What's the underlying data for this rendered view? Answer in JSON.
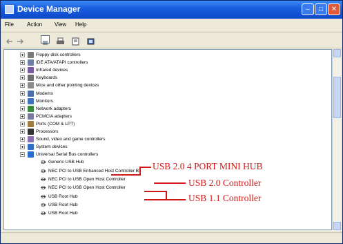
{
  "window": {
    "title": "Device Manager"
  },
  "menu": [
    "File",
    "Action",
    "View",
    "Help"
  ],
  "tree": {
    "categories": [
      {
        "label": "Floppy disk controllers",
        "icon": "floppy-controller-icon"
      },
      {
        "label": "IDE ATA/ATAPI controllers",
        "icon": "ide-controller-icon"
      },
      {
        "label": "Infrared devices",
        "icon": "infrared-icon"
      },
      {
        "label": "Keyboards",
        "icon": "keyboard-icon"
      },
      {
        "label": "Mice and other pointing devices",
        "icon": "mouse-icon"
      },
      {
        "label": "Modems",
        "icon": "modem-icon"
      },
      {
        "label": "Monitors",
        "icon": "monitor-icon"
      },
      {
        "label": "Network adapters",
        "icon": "network-adapter-icon"
      },
      {
        "label": "PCMCIA adapters",
        "icon": "pcmcia-icon"
      },
      {
        "label": "Ports (COM & LPT)",
        "icon": "port-icon"
      },
      {
        "label": "Processors",
        "icon": "processor-icon"
      },
      {
        "label": "Sound, video and game controllers",
        "icon": "sound-icon"
      },
      {
        "label": "System devices",
        "icon": "system-device-icon"
      },
      {
        "label": "Universal Serial Bus controllers",
        "icon": "usb-icon"
      }
    ],
    "usb_children": [
      "Generic USB Hub",
      "NEC PCI to USB Enhanced Host Controller B1",
      "NEC PCI to USB Open Host Controller",
      "NEC PCI to USB Open Host Controller",
      "USB Root Hub",
      "USB Root Hub",
      "USB Root Hub"
    ]
  },
  "annotations": {
    "hub": "USB 2.0 4 PORT MINI HUB",
    "usb2": "USB 2.0 Controller",
    "usb11": "USB 1.1 Controller"
  },
  "colors": {
    "titlebar": "#0b48c9",
    "annotation": "#d01818",
    "window_bg": "#ece9d8"
  }
}
